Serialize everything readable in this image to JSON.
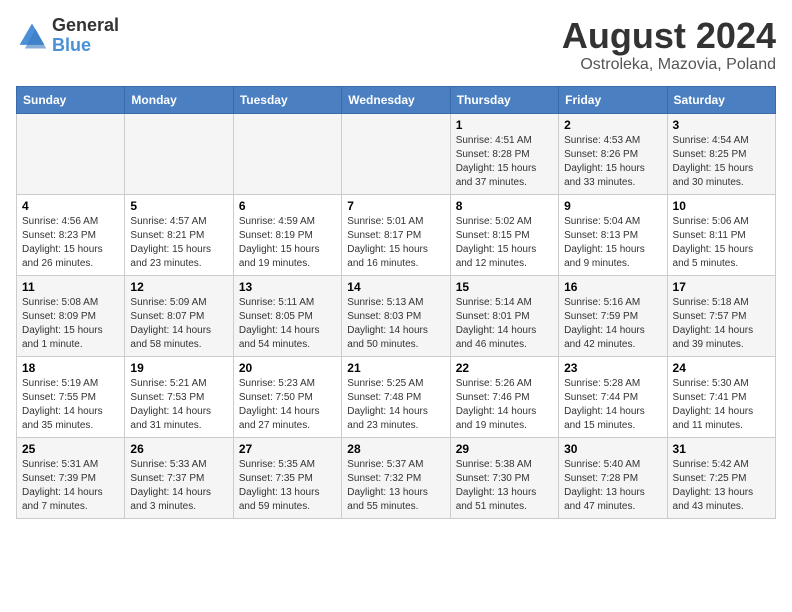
{
  "logo": {
    "general": "General",
    "blue": "Blue"
  },
  "title": "August 2024",
  "subtitle": "Ostroleka, Mazovia, Poland",
  "headers": [
    "Sunday",
    "Monday",
    "Tuesday",
    "Wednesday",
    "Thursday",
    "Friday",
    "Saturday"
  ],
  "weeks": [
    [
      {
        "day": "",
        "info": ""
      },
      {
        "day": "",
        "info": ""
      },
      {
        "day": "",
        "info": ""
      },
      {
        "day": "",
        "info": ""
      },
      {
        "day": "1",
        "info": "Sunrise: 4:51 AM\nSunset: 8:28 PM\nDaylight: 15 hours\nand 37 minutes."
      },
      {
        "day": "2",
        "info": "Sunrise: 4:53 AM\nSunset: 8:26 PM\nDaylight: 15 hours\nand 33 minutes."
      },
      {
        "day": "3",
        "info": "Sunrise: 4:54 AM\nSunset: 8:25 PM\nDaylight: 15 hours\nand 30 minutes."
      }
    ],
    [
      {
        "day": "4",
        "info": "Sunrise: 4:56 AM\nSunset: 8:23 PM\nDaylight: 15 hours\nand 26 minutes."
      },
      {
        "day": "5",
        "info": "Sunrise: 4:57 AM\nSunset: 8:21 PM\nDaylight: 15 hours\nand 23 minutes."
      },
      {
        "day": "6",
        "info": "Sunrise: 4:59 AM\nSunset: 8:19 PM\nDaylight: 15 hours\nand 19 minutes."
      },
      {
        "day": "7",
        "info": "Sunrise: 5:01 AM\nSunset: 8:17 PM\nDaylight: 15 hours\nand 16 minutes."
      },
      {
        "day": "8",
        "info": "Sunrise: 5:02 AM\nSunset: 8:15 PM\nDaylight: 15 hours\nand 12 minutes."
      },
      {
        "day": "9",
        "info": "Sunrise: 5:04 AM\nSunset: 8:13 PM\nDaylight: 15 hours\nand 9 minutes."
      },
      {
        "day": "10",
        "info": "Sunrise: 5:06 AM\nSunset: 8:11 PM\nDaylight: 15 hours\nand 5 minutes."
      }
    ],
    [
      {
        "day": "11",
        "info": "Sunrise: 5:08 AM\nSunset: 8:09 PM\nDaylight: 15 hours\nand 1 minute."
      },
      {
        "day": "12",
        "info": "Sunrise: 5:09 AM\nSunset: 8:07 PM\nDaylight: 14 hours\nand 58 minutes."
      },
      {
        "day": "13",
        "info": "Sunrise: 5:11 AM\nSunset: 8:05 PM\nDaylight: 14 hours\nand 54 minutes."
      },
      {
        "day": "14",
        "info": "Sunrise: 5:13 AM\nSunset: 8:03 PM\nDaylight: 14 hours\nand 50 minutes."
      },
      {
        "day": "15",
        "info": "Sunrise: 5:14 AM\nSunset: 8:01 PM\nDaylight: 14 hours\nand 46 minutes."
      },
      {
        "day": "16",
        "info": "Sunrise: 5:16 AM\nSunset: 7:59 PM\nDaylight: 14 hours\nand 42 minutes."
      },
      {
        "day": "17",
        "info": "Sunrise: 5:18 AM\nSunset: 7:57 PM\nDaylight: 14 hours\nand 39 minutes."
      }
    ],
    [
      {
        "day": "18",
        "info": "Sunrise: 5:19 AM\nSunset: 7:55 PM\nDaylight: 14 hours\nand 35 minutes."
      },
      {
        "day": "19",
        "info": "Sunrise: 5:21 AM\nSunset: 7:53 PM\nDaylight: 14 hours\nand 31 minutes."
      },
      {
        "day": "20",
        "info": "Sunrise: 5:23 AM\nSunset: 7:50 PM\nDaylight: 14 hours\nand 27 minutes."
      },
      {
        "day": "21",
        "info": "Sunrise: 5:25 AM\nSunset: 7:48 PM\nDaylight: 14 hours\nand 23 minutes."
      },
      {
        "day": "22",
        "info": "Sunrise: 5:26 AM\nSunset: 7:46 PM\nDaylight: 14 hours\nand 19 minutes."
      },
      {
        "day": "23",
        "info": "Sunrise: 5:28 AM\nSunset: 7:44 PM\nDaylight: 14 hours\nand 15 minutes."
      },
      {
        "day": "24",
        "info": "Sunrise: 5:30 AM\nSunset: 7:41 PM\nDaylight: 14 hours\nand 11 minutes."
      }
    ],
    [
      {
        "day": "25",
        "info": "Sunrise: 5:31 AM\nSunset: 7:39 PM\nDaylight: 14 hours\nand 7 minutes."
      },
      {
        "day": "26",
        "info": "Sunrise: 5:33 AM\nSunset: 7:37 PM\nDaylight: 14 hours\nand 3 minutes."
      },
      {
        "day": "27",
        "info": "Sunrise: 5:35 AM\nSunset: 7:35 PM\nDaylight: 13 hours\nand 59 minutes."
      },
      {
        "day": "28",
        "info": "Sunrise: 5:37 AM\nSunset: 7:32 PM\nDaylight: 13 hours\nand 55 minutes."
      },
      {
        "day": "29",
        "info": "Sunrise: 5:38 AM\nSunset: 7:30 PM\nDaylight: 13 hours\nand 51 minutes."
      },
      {
        "day": "30",
        "info": "Sunrise: 5:40 AM\nSunset: 7:28 PM\nDaylight: 13 hours\nand 47 minutes."
      },
      {
        "day": "31",
        "info": "Sunrise: 5:42 AM\nSunset: 7:25 PM\nDaylight: 13 hours\nand 43 minutes."
      }
    ]
  ]
}
